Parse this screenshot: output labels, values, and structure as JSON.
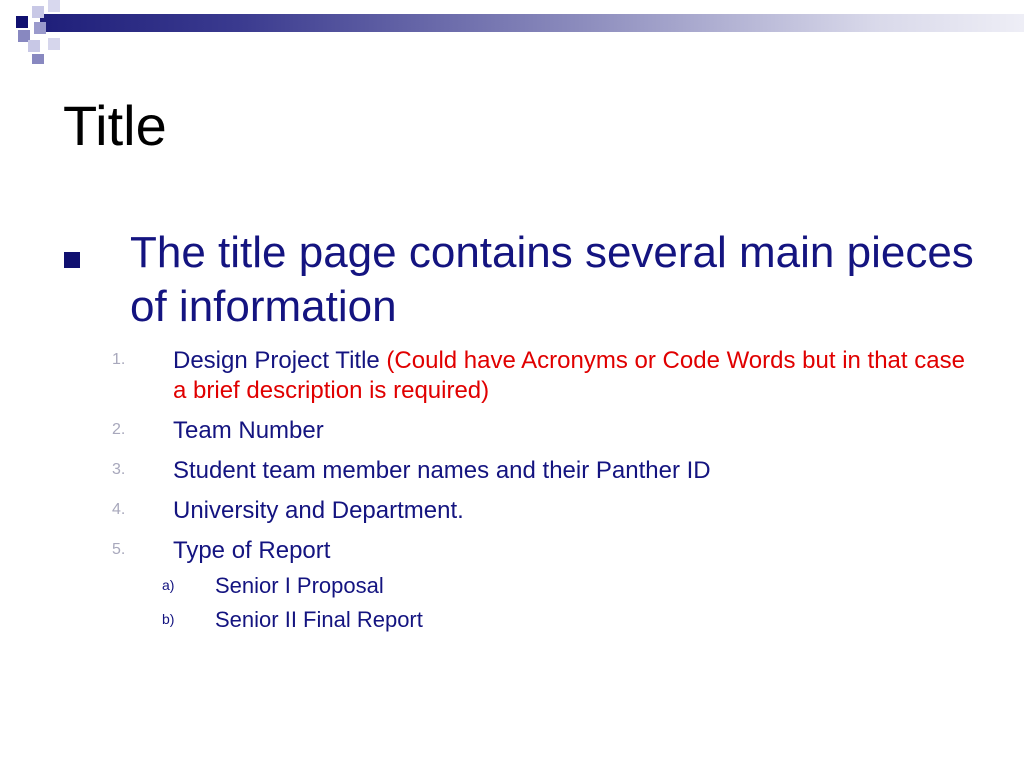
{
  "slide": {
    "title": "Title",
    "bullet": "The title page contains several main pieces of information",
    "items": [
      {
        "marker": "1.",
        "text": "Design Project Title ",
        "note": "(Could have Acronyms or Code Words but in that case a brief description is required)"
      },
      {
        "marker": "2.",
        "text": "Team Number"
      },
      {
        "marker": "3.",
        "text": "Student team member names and their Panther ID"
      },
      {
        "marker": "4.",
        "text": "University and Department."
      },
      {
        "marker": "5.",
        "text": "Type of Report"
      }
    ],
    "subitems": [
      {
        "marker": "a)",
        "text": "Senior I Proposal"
      },
      {
        "marker": "b)",
        "text": "Senior II Final Report"
      }
    ]
  },
  "colors": {
    "title": "#000000",
    "body_text": "#141480",
    "note_text": "#e00000",
    "number_markers": "#a8a8bc",
    "decoration_dark": "#101070",
    "decoration_light": "#8888c0"
  }
}
